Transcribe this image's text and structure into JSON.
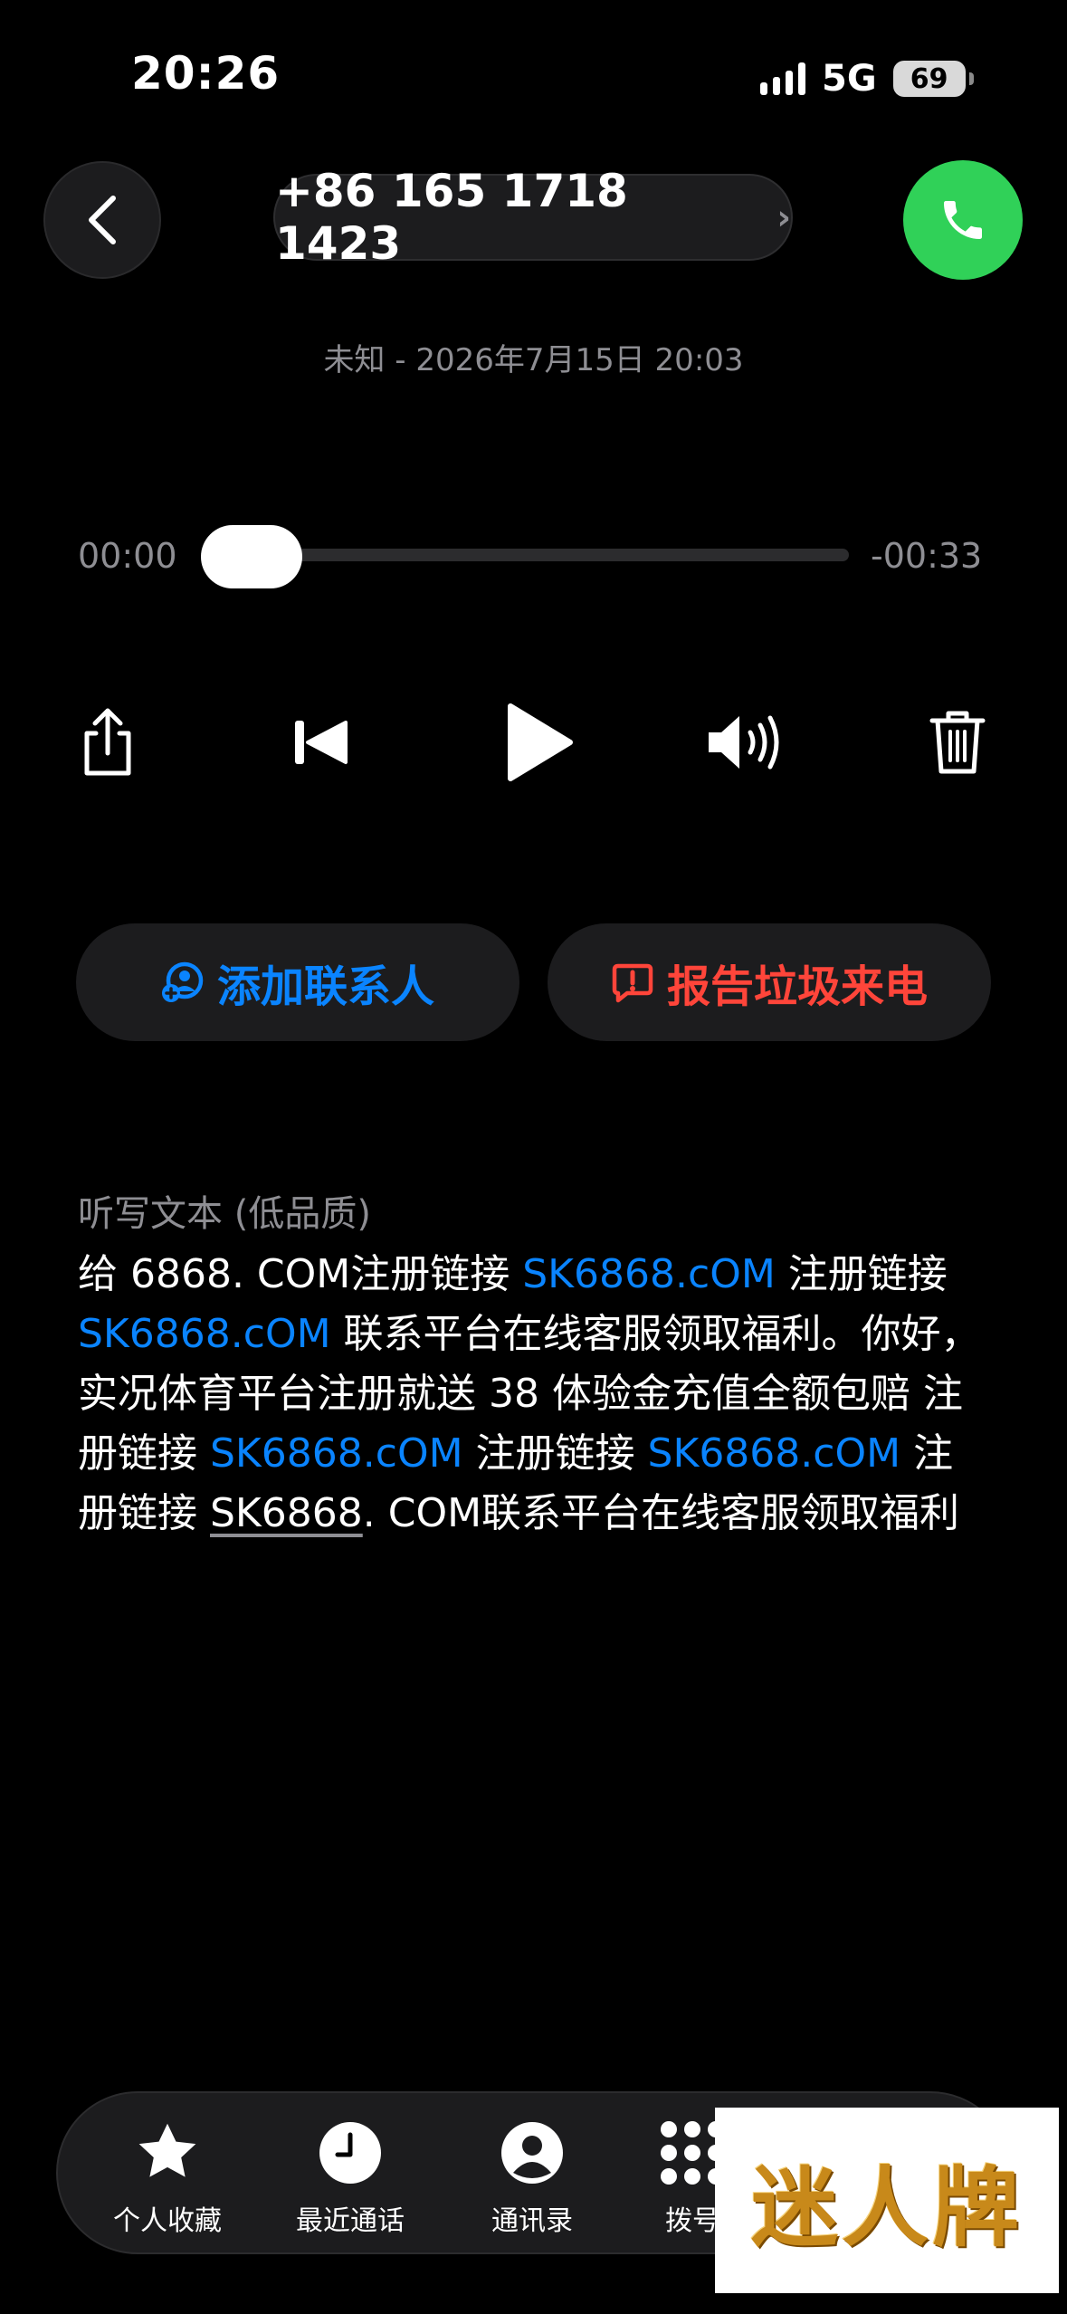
{
  "status_bar": {
    "time": "20:26",
    "network": "5G",
    "battery": "69"
  },
  "header": {
    "phone_number": "+86 165 1718 1423",
    "chevron": "›"
  },
  "call_info": "未知 - 2026年7月15日 20:03",
  "player": {
    "elapsed": "00:00",
    "remaining": "-00:33",
    "progress": 0
  },
  "actions": {
    "add_contact": "添加联系人",
    "report_spam": "报告垃圾来电"
  },
  "transcript": {
    "label": "听写文本 (低品质)",
    "segments": [
      {
        "t": "给 6868. COM注册链接 ",
        "c": ""
      },
      {
        "t": "SK6868.cOM",
        "c": "link"
      },
      {
        "t": " 注册链接 ",
        "c": ""
      },
      {
        "t": "SK6868.cOM",
        "c": "link"
      },
      {
        "t": " 联系平台在线客服领取福利。你好， 实况体育平台注册就送 38 体验金充值全额包赔 注册链接 ",
        "c": ""
      },
      {
        "t": "SK6868.cOM",
        "c": "link"
      },
      {
        "t": " 注册链接 ",
        "c": ""
      },
      {
        "t": "SK6868.cOM",
        "c": "link"
      },
      {
        "t": " 注册链接 ",
        "c": ""
      },
      {
        "t": "SK6868",
        "c": "ul"
      },
      {
        "t": ". COM联系平台在线客服领取福利",
        "c": ""
      }
    ]
  },
  "tabs": [
    {
      "label": "个人收藏",
      "icon": "star-icon"
    },
    {
      "label": "最近通话",
      "icon": "clock-icon"
    },
    {
      "label": "通讯录",
      "icon": "person-icon"
    },
    {
      "label": "拨号",
      "icon": "keypad-icon"
    }
  ],
  "watermark": "迷人牌",
  "colors": {
    "accent_blue": "#0a84ff",
    "accent_red": "#ff453a",
    "call_green": "#30d158"
  }
}
